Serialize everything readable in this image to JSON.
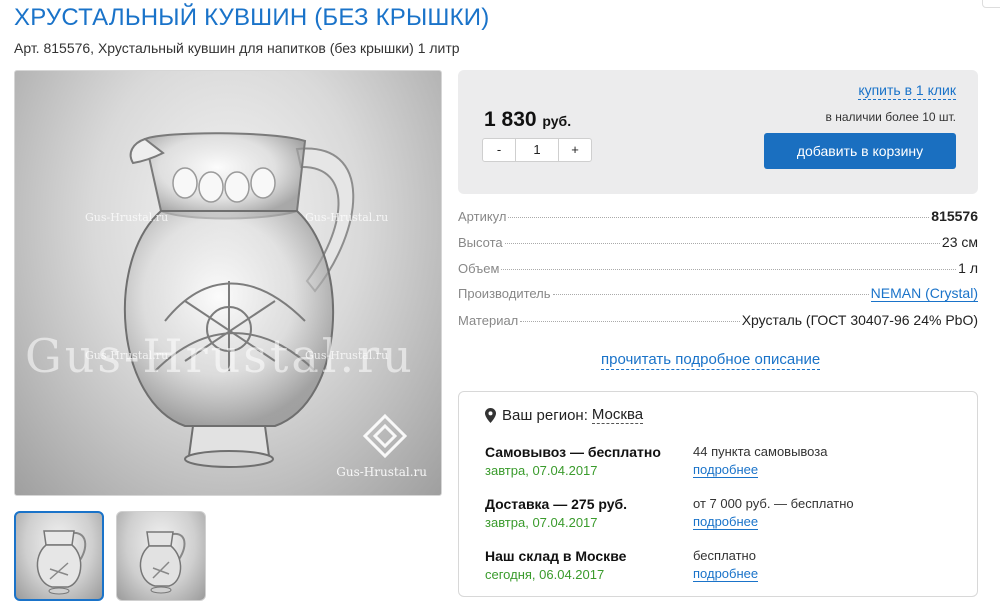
{
  "product": {
    "title": "ХРУСТАЛЬНЫЙ КУВШИН (БЕЗ КРЫШКИ)",
    "subtitle": "Арт. 815576, Хрустальный кувшин для напитков (без крышки) 1 литр"
  },
  "gallery": {
    "watermark_big": "Gus-Hrustal.ru",
    "watermark_small": "Gus-Hrustal.ru",
    "brand_mark": "Gus-Hrustal.ru",
    "thumbnails_count": 2,
    "selected_thumbnail": 1
  },
  "buy": {
    "price": "1 830",
    "price_unit": "руб.",
    "qty_minus": "-",
    "qty_value": "1",
    "qty_plus": "+",
    "one_click": "купить в 1 клик",
    "stock": "в наличии более 10 шт.",
    "add_to_cart": "добавить в корзину"
  },
  "specs": [
    {
      "label": "Артикул",
      "value": "815576"
    },
    {
      "label": "Высота",
      "value": "23 см"
    },
    {
      "label": "Объем",
      "value": "1 л"
    },
    {
      "label": "Производитель",
      "value": "NEMAN (Crystal)"
    },
    {
      "label": "Материал",
      "value": "Хрусталь (ГОСТ 30407-96 24% PbO)"
    }
  ],
  "read_more": "прочитать подробное описание",
  "delivery": {
    "region_label": "Ваш регион:",
    "region_city": "Москва",
    "options": [
      {
        "name": "Самовывоз — бесплатно",
        "date": "завтра, 07.04.2017",
        "info": "44 пункта самовывоза",
        "more": "подробнее"
      },
      {
        "name": "Доставка — 275 руб.",
        "date": "завтра, 07.04.2017",
        "info": "от 7 000 руб. — бесплатно",
        "more": "подробнее"
      },
      {
        "name": "Наш склад в Москве",
        "date": "сегодня, 06.04.2017",
        "info": "бесплатно",
        "more": "подробнее"
      }
    ]
  },
  "colors": {
    "accent": "#1a73c9",
    "button": "#1a6fc0",
    "date_green": "#3a9b2c"
  }
}
